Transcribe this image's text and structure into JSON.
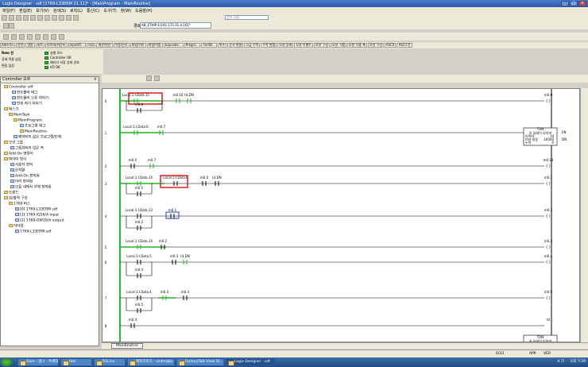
{
  "window": {
    "title": "Logix Designer - sdf [1769-L33ERM 21.11]* - [MainProgram - MainRoutine]"
  },
  "menu": [
    "파일(F)",
    "편집(E)",
    "보기(V)",
    "검색(S)",
    "로직(L)",
    "통신(C)",
    "도구(T)",
    "창(W)",
    "도움말(H)"
  ],
  "search": {
    "placeholder": "검색 모듈"
  },
  "path": {
    "label": "경로:",
    "value": "AB_ETHIP-1\\192.172.31.4.161*"
  },
  "controller_status": {
    "mode": "Rem 런",
    "forces": "강제 적용 없음",
    "edits": "편집 없음",
    "indicators": [
      "실행 모드",
      "Controller OK",
      "배터리 저장 상태 양호",
      "I/O OK"
    ]
  },
  "instruction_tabs": [
    "Add-On",
    "안전",
    "알람",
    "비트",
    "타이머/카운터",
    "Input/O...",
    "비교",
    "계산/연산",
    "이동/논리",
    "파일/기타",
    "파일/이동",
    "Equivale...",
    "Progra...",
    "For/Br...",
    "특수",
    "순서 변환",
    "고급 수학",
    "수학 변환",
    "모션 상태",
    "모션 이벤트",
    "모션 구성",
    "모션 그룹",
    "모션 다중 축",
    "모션 구성",
    "ASCII",
    "ASCII 문"
  ],
  "organizer": {
    "title": "Controller 오르",
    "items": [
      "Controller sdf",
      "컨트롤러 태그",
      "컨트롤러 오류 처리기",
      "전원 켜기 처리기",
      "태스크",
      "MainTask",
      "MainProgram",
      "프로그램 태그",
      "MainRoutine",
      "예약되지 않은 프로그램/단계",
      "모션 그룹",
      "그룹화되지 않은 축",
      "Add-On 명령어",
      "데이터 형식",
      "사용자 정의",
      "문자열",
      "Add-On 정의됨",
      "미리 정의됨",
      "모듈 내에서 자체 정의됨",
      "트렌드",
      "입/출력 구성",
      "1769 버스",
      "[0] 1769-L33ERM sdf",
      "[1] 1769-IQ16/A input",
      "[2] 1769-OW16/A output",
      "이더넷",
      "1769-L33ERM sdf"
    ]
  },
  "ladder": {
    "rungs": [
      {
        "number": "0",
        "labels": [
          "Local:1:I.Data.15",
          "m0.10",
          "t4.DN",
          "m0.0",
          "m0.0"
        ]
      },
      {
        "number": "1",
        "labels": [
          "Local:1:I.Data.6",
          "m0.7"
        ]
      },
      {
        "number": "2",
        "labels": [
          "m0.0",
          "m0.7",
          "m0.19"
        ]
      },
      {
        "number": "3",
        "labels": [
          "Local:1:I.Data.14",
          "Local:1:I.Data.6",
          "m0.0",
          "t3.DN",
          "m0.1",
          "m0.1"
        ]
      },
      {
        "number": "4",
        "labels": [
          "Local:1:I.Data.13",
          "m0.1",
          "m0.2",
          "m0.2"
        ]
      },
      {
        "number": "5",
        "labels": [
          "Local:1:I.Data.14",
          "m0.2",
          "m0.3"
        ]
      },
      {
        "number": "6",
        "labels": [
          "Local:1:I.Data.5",
          "m0.3",
          "t3.DN",
          "m0.4",
          "m0.4"
        ]
      },
      {
        "number": "7",
        "labels": [
          "Local:1:I.Data.4",
          "m0.4",
          "m0.3",
          "m0.5",
          "m0.5"
        ]
      },
      {
        "number": "8",
        "labels": [
          "m0.4",
          "t4"
        ]
      }
    ],
    "ton": {
      "title": "TON",
      "name": "온 딜레이 타이머",
      "rows": [
        "타이머",
        "t4",
        "미리 설정",
        "10000",
        "누적",
        "0"
      ],
      "pins": [
        "EN",
        "DN"
      ]
    },
    "ton_bottom": {
      "title": "TON",
      "name": "온 딜레이 타이머"
    }
  },
  "routine_tab": "MainRoutine",
  "status": {
    "rung": "6/33",
    "app": "APP",
    "ver": "VER"
  },
  "taskbar": {
    "buttons": [
      "Gom - 말나 - 폭세대...",
      "feel",
      "RSLinx",
      "팩토리토크 - vkdmqkp...",
      "FactoryTalk View St...",
      "Logix Designer - sdf"
    ],
    "active": 5,
    "clock": "오후 7:29",
    "tray": "A 가"
  },
  "colors": {
    "rail": "#2bbd2b",
    "highlight": "#e11d1d",
    "energized": "#1fb81f"
  }
}
